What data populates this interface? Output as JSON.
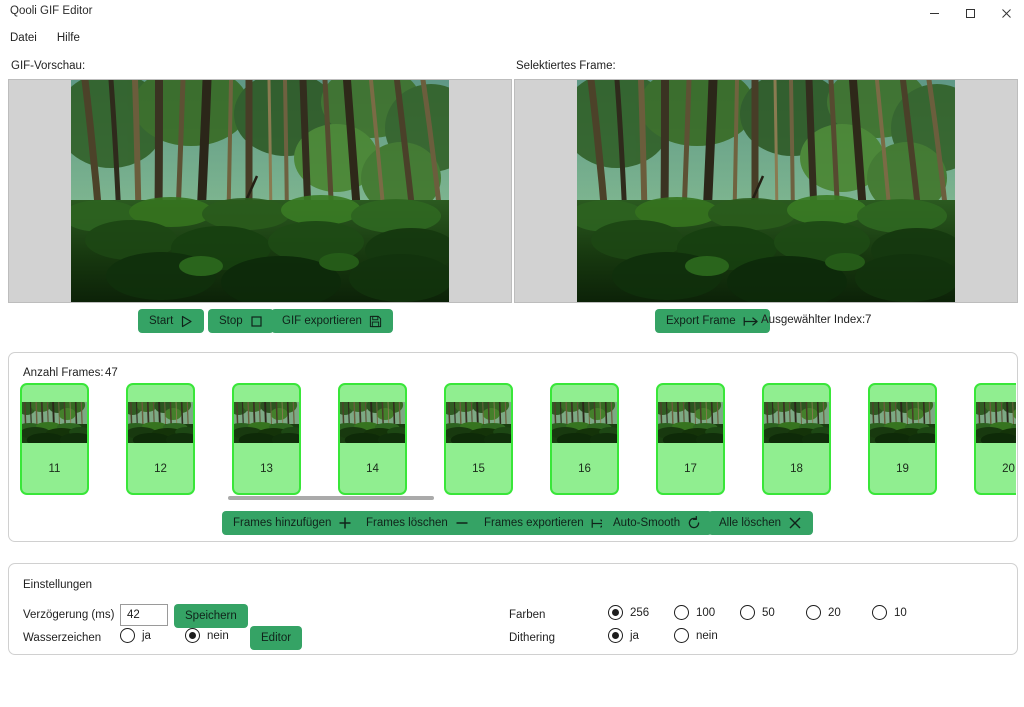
{
  "window": {
    "title": "Qooli GIF Editor",
    "controls": [
      {
        "name": "minimize",
        "glyph": "minimize-icon"
      },
      {
        "name": "maximize",
        "glyph": "maximize-icon"
      },
      {
        "name": "close",
        "glyph": "close-icon"
      }
    ]
  },
  "menu": {
    "items": [
      "Datei",
      "Hilfe"
    ]
  },
  "preview": {
    "left_label": "GIF-Vorschau:",
    "right_label": "Selektiertes Frame:"
  },
  "playback": {
    "start_label": "Start",
    "start_icon": "play-icon",
    "stop_label": "Stop",
    "stop_icon": "stop-icon",
    "export_gif_label": "GIF exportieren",
    "export_gif_icon": "save-icon"
  },
  "selected_frame": {
    "export_label": "Export Frame",
    "export_icon": "export-arrow-icon",
    "index_label": "Ausgewählter Index:",
    "index_value": "7"
  },
  "frames": {
    "count_label": "Anzahl Frames:",
    "count_value": "47",
    "items": [
      {
        "number": "11"
      },
      {
        "number": "12"
      },
      {
        "number": "13"
      },
      {
        "number": "14"
      },
      {
        "number": "15"
      },
      {
        "number": "16"
      },
      {
        "number": "17"
      },
      {
        "number": "18"
      },
      {
        "number": "19"
      },
      {
        "number": "20"
      }
    ],
    "toolbar": [
      {
        "label": "Frames hinzufügen",
        "icon": "plus-icon"
      },
      {
        "label": "Frames löschen",
        "icon": "minus-icon"
      },
      {
        "label": "Frames exportieren",
        "icon": "export-arrow-icon"
      },
      {
        "label": "Auto-Smooth",
        "icon": "refresh-icon"
      },
      {
        "label": "Alle löschen",
        "icon": "x-icon"
      }
    ]
  },
  "settings": {
    "title": "Einstellungen",
    "delay_label": "Verzögerung (ms)",
    "delay_value": "42",
    "save_label": "Speichern",
    "watermark_label": "Wasserzeichen",
    "watermark_yes": "ja",
    "watermark_no": "nein",
    "watermark_selected": "nein",
    "editor_label": "Editor",
    "colors_label": "Farben",
    "colors_options": [
      "256",
      "100",
      "50",
      "20",
      "10"
    ],
    "colors_selected": "256",
    "dithering_label": "Dithering",
    "dithering_yes": "ja",
    "dithering_no": "nein",
    "dithering_selected": "ja"
  },
  "theme": {
    "button_green": "#35a365",
    "frame_card_green": "#90ee90",
    "frame_card_border": "#39e639",
    "preview_bg": "#d2d2d2"
  }
}
